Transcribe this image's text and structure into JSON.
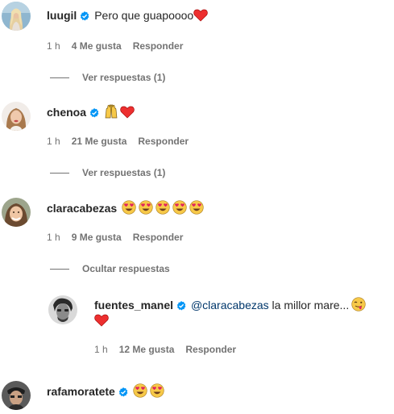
{
  "comments": [
    {
      "username": "luugil",
      "text": "Pero que guapoooo",
      "time": "1 h",
      "likes": "4 Me gusta",
      "reply": "Responder",
      "replies_toggle": "Ver respuestas (1)"
    },
    {
      "username": "chenoa",
      "text": "",
      "time": "1 h",
      "likes": "21 Me gusta",
      "reply": "Responder",
      "replies_toggle": "Ver respuestas (1)"
    },
    {
      "username": "claracabezas",
      "text": "",
      "time": "1 h",
      "likes": "9 Me gusta",
      "reply": "Responder",
      "replies_toggle": "Ocultar respuestas"
    },
    {
      "username": "rafamoratete",
      "text": ""
    }
  ],
  "reply": {
    "username": "fuentes_manel",
    "mention": "@claracabezas",
    "text": " la millor mare...",
    "time": "1 h",
    "likes": "12 Me gusta",
    "reply": "Responder"
  },
  "colors": {
    "verified": "#0095f6",
    "heart": "#ed2f2f",
    "mention": "#00376b",
    "meta": "#737373"
  },
  "icons": [
    "verified-badge-icon",
    "red-heart-icon",
    "heart-eyes-face-icon",
    "raising-hands-icon",
    "winking-tongue-face-icon"
  ]
}
